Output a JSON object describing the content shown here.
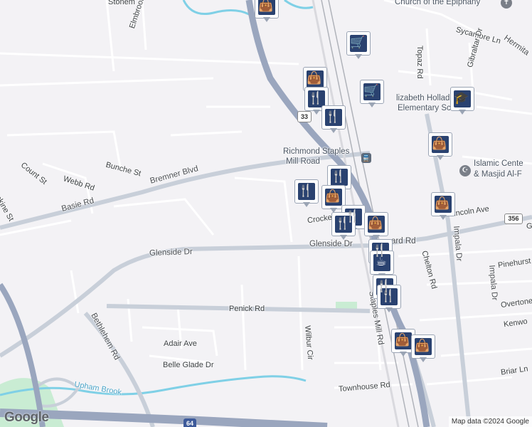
{
  "map": {
    "streets": {
      "stonemill": "Stonem",
      "elmbrook": "Elmbrook Rd",
      "sycamore": "Sycamore Ln",
      "topaz": "Topaz Rd",
      "gibraltar": "Gibraltar Dr",
      "hermitage": "Hermita",
      "count": "Count St",
      "webb": "Webb Rd",
      "bunche": "Bunche St",
      "bremner": "Bremner Blvd",
      "basie": "Basie Rd",
      "erskine": "rskine St",
      "crocker": "Crocke",
      "lincoln": "incoln Ave",
      "glenside_w": "Glenside Dr",
      "glenside_e": "Glenside Dr",
      "glenside_rd": "ard Rd",
      "chelton": "Chelton Rd",
      "impala_1": "Impala Dr",
      "impala_2": "Impala Dr",
      "pinehurst": "Pinehurst",
      "overton": "Overtone",
      "kenwood": "Kenwo",
      "penick": "Penick Rd",
      "bethlehem": "Bethlehem Rd",
      "staples_mill": "Staples Mill Rd",
      "adair": "Adair Ave",
      "belle_glade": "Belle Glade Dr",
      "wilbur": "Wilbur Cir",
      "townhouse": "Townhouse Rd",
      "briar": "Briar Ln",
      "upham": "Upham Brook",
      "g_right": "G"
    },
    "pois": {
      "church": "Church of the Epiphany",
      "school_1": "lizabeth Hollad",
      "school_2": "Elementary Scho",
      "islamic_1": "Islamic Cente",
      "islamic_2": "& Masjid Al-F",
      "station_1": "Richmond Staples",
      "station_2": "Mill Road"
    },
    "shields": {
      "us33": "33",
      "va356": "356",
      "i64": "64"
    },
    "branding": {
      "google": "Google",
      "attribution": "Map data ©2024 Google"
    },
    "markers": [
      {
        "icon": "shopping-bag-icon",
        "glyph": "👜"
      },
      {
        "icon": "cart-icon",
        "glyph": "🛒"
      },
      {
        "icon": "shopping-bag-icon",
        "glyph": "👜"
      },
      {
        "icon": "restaurant-icon",
        "glyph": "🍴"
      },
      {
        "icon": "cart-icon",
        "glyph": "🛒"
      },
      {
        "icon": "restaurant-icon",
        "glyph": "🍴"
      },
      {
        "icon": "school-icon",
        "glyph": "🎓"
      },
      {
        "icon": "shopping-bag-icon",
        "glyph": "👜"
      },
      {
        "icon": "restaurant-icon",
        "glyph": "🍴"
      },
      {
        "icon": "restaurant-icon",
        "glyph": "🍴"
      },
      {
        "icon": "shopping-bag-icon",
        "glyph": "👜"
      },
      {
        "icon": "shopping-bag-icon",
        "glyph": "👜"
      },
      {
        "icon": "restaurant-icon",
        "glyph": "🍴"
      },
      {
        "icon": "restaurant-icon",
        "glyph": "🍴"
      },
      {
        "icon": "shopping-bag-icon",
        "glyph": "👜"
      },
      {
        "icon": "restaurant-icon",
        "glyph": "🍴"
      },
      {
        "icon": "cafe-icon",
        "glyph": "☕"
      },
      {
        "icon": "restaurant-icon",
        "glyph": "🍴"
      },
      {
        "icon": "restaurant-icon",
        "glyph": "🍴"
      },
      {
        "icon": "shopping-bag-icon",
        "glyph": "👜"
      },
      {
        "icon": "shopping-bag-icon",
        "glyph": "👜"
      }
    ],
    "colors": {
      "background": "#f3f2f5",
      "highway": "#9aa6be",
      "major_road": "#c8cfd9",
      "water": "#7fd0e6",
      "park": "#c9ecd3",
      "marker_fill": "#2a4270"
    }
  }
}
